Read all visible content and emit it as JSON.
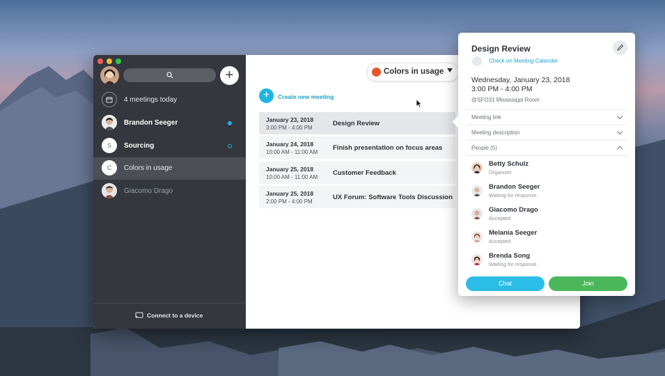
{
  "window": {
    "traffic_colors": [
      "#f45f57",
      "#f5bd2f",
      "#2ac940"
    ]
  },
  "sidebar": {
    "search_icon": "search-icon",
    "add_label": "+",
    "items": [
      {
        "label": "4 meetings today",
        "icon": "calendar-icon"
      },
      {
        "label": "Brandon Seeger",
        "avatar": "photo",
        "unread": true
      },
      {
        "label": "Sourcing",
        "initial": "S",
        "unread": true
      },
      {
        "label": "Colors in usage",
        "initial": "C",
        "selected": true
      },
      {
        "label": "Giacomo Drago",
        "avatar": "photo"
      }
    ],
    "connect_label": "Connect to a device"
  },
  "main": {
    "space_name": "Colors in usage",
    "create_label": "Create new meeting",
    "meetings": [
      {
        "date": "January 23, 2018",
        "time": "3:00 PM - 4:00 PM",
        "title": "Design Review",
        "selected": true
      },
      {
        "date": "January 24, 2018",
        "time": "10:00 AM - 11:00 AM",
        "title": "Finish presentation on focus areas"
      },
      {
        "date": "January 25, 2018",
        "time": "10:00 AM - 11:00 AM",
        "title": "Customer Feedback"
      },
      {
        "date": "January 25, 2018",
        "time": "2:00 PM - 4:00 PM",
        "title": "UX Forum: Software Tools Discussion"
      }
    ]
  },
  "popover": {
    "title": "Design Review",
    "calendar_link": "Check on Meeting Calender",
    "date": "Wednesday, January 23, 2018",
    "time": "3:00 PM - 4:00 PM",
    "room": "@SFO31 Mississippi Room",
    "sections": {
      "link": "Meeting link",
      "description": "Meeting description",
      "people": "People (5)"
    },
    "people": [
      {
        "name": "Betty Schulz",
        "status": "Organizer"
      },
      {
        "name": "Brandon Seeger",
        "status": "Waiting for response"
      },
      {
        "name": "Giacomo Drago",
        "status": "Accepted"
      },
      {
        "name": "Melania Seeger",
        "status": "Accepted"
      },
      {
        "name": "Brenda Song",
        "status": "Waiting for response"
      }
    ],
    "chat_label": "Chat",
    "join_label": "Join"
  }
}
